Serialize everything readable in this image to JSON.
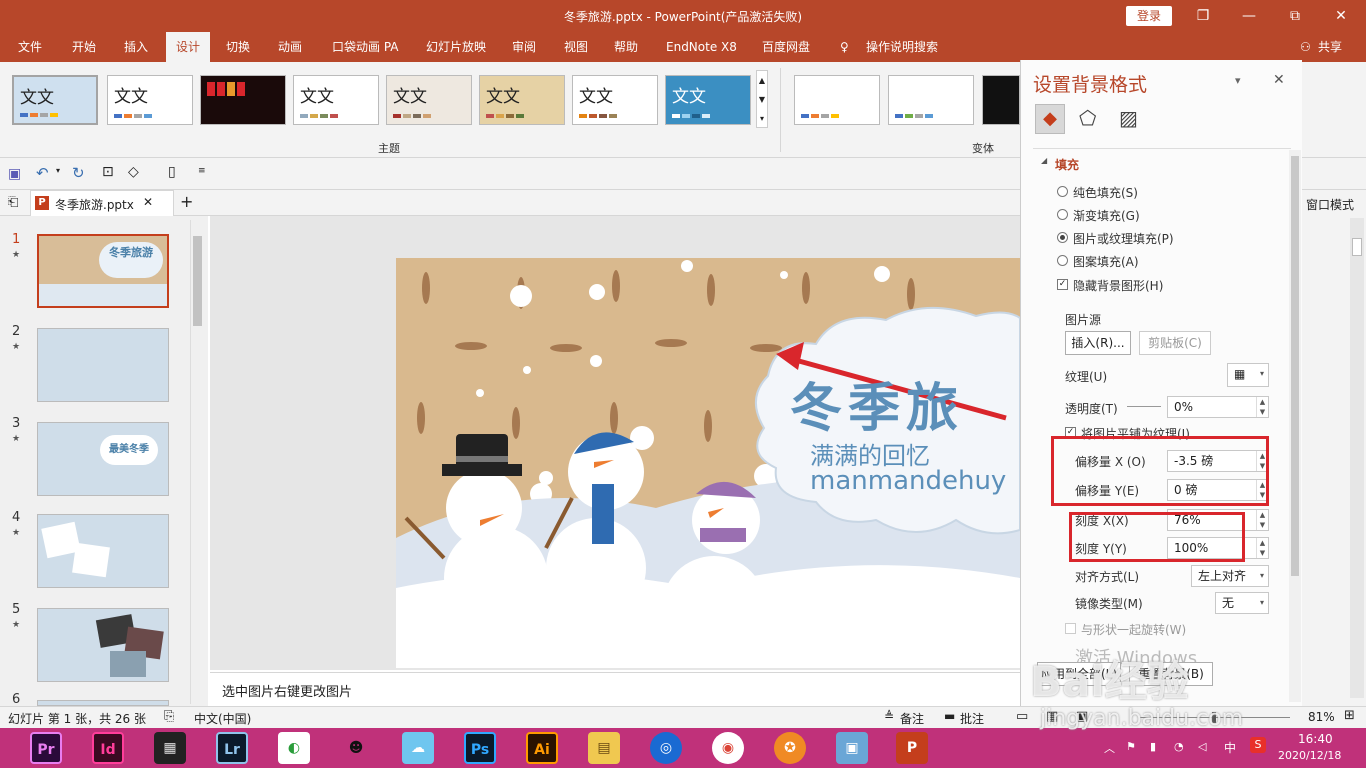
{
  "window": {
    "title": "冬季旅游.pptx  -  PowerPoint(产品激活失败)",
    "login": "登录",
    "min": "—",
    "restore": "❐",
    "max": "⧉",
    "close": "✕"
  },
  "menu": {
    "tabs": [
      "文件",
      "开始",
      "插入",
      "设计",
      "切换",
      "动画",
      "口袋动画 PA",
      "幻灯片放映",
      "审阅",
      "视图",
      "帮助",
      "EndNote X8",
      "百度网盘"
    ],
    "tell": "操作说明搜索",
    "share": "共享",
    "active": "设计"
  },
  "ribbon": {
    "theme_text": "文文",
    "themes_group": "主题",
    "variants_group": "变体"
  },
  "doc": {
    "tab": "冬季旅游.pptx",
    "close": "✕",
    "add": "+"
  },
  "thumbs": {
    "numbers": [
      "1",
      "2",
      "3",
      "4",
      "5",
      "6"
    ],
    "star": "★",
    "t1_title": "冬季旅游",
    "t3_title": "最美冬季"
  },
  "slide": {
    "title": "冬季旅",
    "subtitle": "满满的回忆",
    "url": "manmandehuy"
  },
  "notes": {
    "text": "选中图片右键更改图片"
  },
  "pane": {
    "title": "设置背景格式",
    "collapse": "▾",
    "close": "✕",
    "section": "填充",
    "fill_options": [
      "纯色填充(S)",
      "渐变填充(G)",
      "图片或纹理填充(P)",
      "图案填充(A)"
    ],
    "hide_bg": "隐藏背景图形(H)",
    "picture_source": "图片源",
    "insert": "插入(R)...",
    "clipboard": "剪贴板(C)",
    "texture": "纹理(U)",
    "transparency": "透明度(T)",
    "transparency_value": "0%",
    "tile": "将图片平铺为纹理(I)",
    "offset_x": "偏移量 X (O)",
    "offset_x_value": "-3.5 磅",
    "offset_y": "偏移量 Y(E)",
    "offset_y_value": "0 磅",
    "scale_x": "刻度 X(X)",
    "scale_x_value": "76%",
    "scale_y": "刻度 Y(Y)",
    "scale_y_value": "100%",
    "align": "对齐方式(L)",
    "align_value": "左上对齐",
    "mirror": "镜像类型(M)",
    "mirror_value": "无",
    "rotate": "与形状一起旋转(W)",
    "apply_all": "应用到全部(L)",
    "reset": "重置背景(B)",
    "activate": "激活 Windows"
  },
  "strip": {
    "window_mode": "窗口模式"
  },
  "status": {
    "slide": "幻灯片 第 1 张，共 26 张",
    "lang": "中文(中国)",
    "notes": "备注",
    "comments": "批注",
    "zoom": "81%"
  },
  "taskbar": {
    "apps": [
      "Pr",
      "Id",
      "▦",
      "Lr",
      "◐",
      "☻",
      "☁",
      "Ps",
      "Ai",
      "▤",
      "◎",
      "◉",
      "✪",
      "▣",
      "P"
    ],
    "time": "16:40",
    "date": "2020/12/18",
    "ime": "中",
    "sogou": "S"
  },
  "watermark": {
    "brand": "Bai经验",
    "url": "jingyan.baidu.com"
  }
}
